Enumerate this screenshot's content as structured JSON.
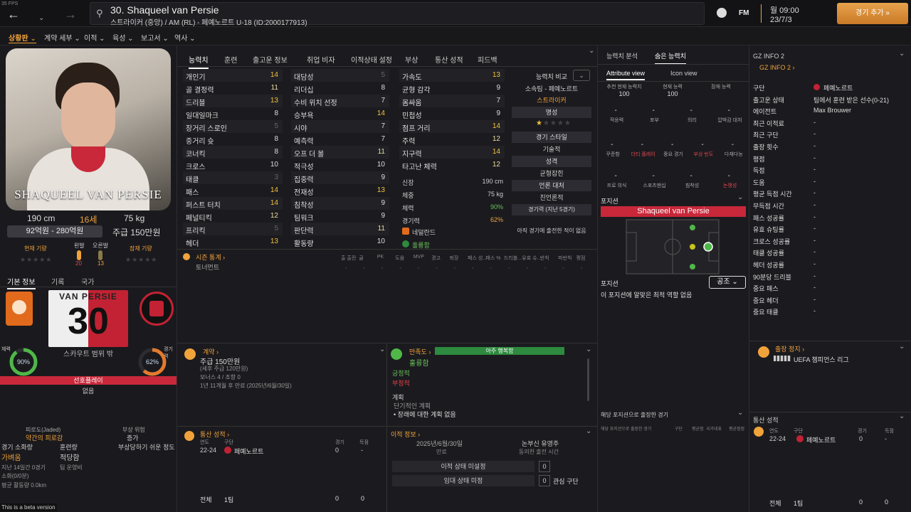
{
  "fps": "35 FPS",
  "header": {
    "title": "30. Shaqueel van Persie",
    "subtitle": "스트라이커 (중앙) / AM (RL) - 페예노르트 U-18 (ID:2000177913)",
    "fm_label": "FM",
    "day_time": "월 09:00",
    "date": "23/7/3",
    "continue_label": "경기 추가"
  },
  "subnav": [
    "상황판",
    "계약 세부",
    "이적",
    "육성",
    "보고서",
    "역사"
  ],
  "profile": {
    "name_overlay": "SHAQUEEL VAN PERSIE",
    "height": "190 cm",
    "age": "16세",
    "weight": "75 kg",
    "value_range": "92억원 - 280억원",
    "wage": "주급 150만원",
    "current_ability_label": "현재 기량",
    "left_foot_label": "왼발",
    "left_foot_value": "20",
    "right_foot_label": "오른발",
    "right_foot_value": "13",
    "potential_label": "잠재 기량"
  },
  "side_tabs": [
    "기본 정보",
    "기록",
    "국가"
  ],
  "shirt": {
    "name": "VAN PERSIE",
    "number": "30"
  },
  "scouting_label": "스카우트 범위 밖",
  "fitness": {
    "label": "체력",
    "value": "90%",
    "pct": 0.9
  },
  "match_sharp": {
    "label": "경기력",
    "value": "62%",
    "pct": 0.62
  },
  "first_xi": {
    "label": "선호플레이",
    "value": "없음"
  },
  "left_bottom": {
    "fatigue_label": "피로도(Jaded)",
    "fatigue_value": "약간의 피로감",
    "injury_label": "부상 위험",
    "injury_value": "증가",
    "condition_label": "경기 소화량",
    "condition_value": "훈련량",
    "injury_prone": "부상당하기 쉬운 정도",
    "status_value": "가벼움",
    "status2": "적당함",
    "last_year": "지난 14일간 0경기",
    "last_year2": "팀 운영비",
    "minutes": "소화(0/0분)",
    "distance": "평균 활동량 0.0km",
    "beta": "This is a beta version"
  },
  "attr_tabs": [
    "능력치",
    "훈련",
    "출고운 정보",
    "취업 비자",
    "이적상태 설정",
    "부상",
    "통산 성적",
    "피드백"
  ],
  "technical": [
    [
      "개인기",
      "14"
    ],
    [
      "골 결정력",
      "11"
    ],
    [
      "드리블",
      "13"
    ],
    [
      "일대일마크",
      "8"
    ],
    [
      "장거리 스로인",
      "5"
    ],
    [
      "중거리 슛",
      "8"
    ],
    [
      "코너킥",
      "8"
    ],
    [
      "크로스",
      "10"
    ],
    [
      "태클",
      "3"
    ],
    [
      "패스",
      "14"
    ],
    [
      "퍼스트 터치",
      "14"
    ],
    [
      "페널티킥",
      "12"
    ],
    [
      "프리킥",
      "5"
    ],
    [
      "헤더",
      "13"
    ]
  ],
  "mental": [
    [
      "대담성",
      "5"
    ],
    [
      "리더십",
      "8"
    ],
    [
      "수비 위치 선정",
      "7"
    ],
    [
      "승부욕",
      "14"
    ],
    [
      "시야",
      "7"
    ],
    [
      "예측력",
      "7"
    ],
    [
      "오프 더 볼",
      "11"
    ],
    [
      "적극성",
      "10"
    ],
    [
      "집중력",
      "9"
    ],
    [
      "전재성",
      "13"
    ],
    [
      "침착성",
      "9"
    ],
    [
      "팀워크",
      "9"
    ],
    [
      "판단력",
      "11"
    ],
    [
      "활동량",
      "10"
    ]
  ],
  "physical": [
    [
      "가속도",
      "13"
    ],
    [
      "균형 감각",
      "9"
    ],
    [
      "몸싸움",
      "7"
    ],
    [
      "민첩성",
      "9"
    ],
    [
      "점프 거리",
      "14"
    ],
    [
      "주력",
      "12"
    ],
    [
      "지구력",
      "14"
    ],
    [
      "타고난 체력",
      "12"
    ]
  ],
  "details": {
    "height_label": "신장",
    "height": "190 cm",
    "weight_label": "체중",
    "weight": "75 kg",
    "fitness_label": "체력",
    "fitness": "90%",
    "sharp_label": "경기력",
    "sharp": "62%",
    "nation": "네덜란드",
    "condition": "훌륭함"
  },
  "compare": {
    "label": "능력치 비교",
    "club_label": "소속팀 - 페예노르트",
    "role": "스트라이커",
    "rep_label": "명성",
    "style_label": "경기 스타일",
    "style": "기술적",
    "personality_label": "성격",
    "personality": "균형잡힌",
    "media_label": "언론 대처",
    "media": "친언론적",
    "form_label": "경기력 (지난 5경기)",
    "no_games": "아직 경기에 출전한 적이 없음"
  },
  "season": {
    "title": "시즌 통계",
    "tournament": "토너먼트",
    "cols": [
      "출 출전",
      "골",
      "PK",
      "도움",
      "MVP",
      "경고",
      "퇴장",
      "패스 성...",
      "패스 %",
      "드리블...",
      "유효 슈...",
      "반칙",
      "파반칙",
      "평점"
    ]
  },
  "contract": {
    "title": "계약",
    "wage": "주급 150만원",
    "sub1": "(세후 주급 120만원)",
    "sub2": "보너스 4 / 조항 0",
    "sub3": "1년 11개월 후 만료 (2025년/6월/30일)"
  },
  "happiness": {
    "title": "만족도",
    "bar": "아주 행복함",
    "overall": "훌륭함",
    "positive": "긍정적",
    "negative": "부정적",
    "plans": "계획",
    "short": "단기적인 계획",
    "bullet": "장래에 대한 계획 없음"
  },
  "career_mid": {
    "title": "통산 성적",
    "year_label": "연도",
    "club_label": "구단",
    "apps_label": "경기",
    "goals_label": "득점",
    "year": "22-24",
    "club": "페예노르트",
    "apps": "0",
    "goals": "-",
    "total_label": "전체",
    "total_team": "1팀",
    "total_apps": "0",
    "total_goals": "0"
  },
  "transfer": {
    "title": "이적 정보",
    "date": "2025년/6월/30일",
    "date_sub": "만료",
    "option": "논부신 유영주",
    "option_sub": "동의한 출전 시간",
    "status1": "이적 상태 미설정",
    "status1_v": "0",
    "status2": "임대 상태 미정",
    "status2_v": "0",
    "interest": "관심 구단"
  },
  "right_tabs": [
    "능력치 분석",
    "숨은 능력치"
  ],
  "view_tabs": [
    "Attribute view",
    "Icon view"
  ],
  "ability": {
    "rec_label": "추천 현재 능력치",
    "rec": "100",
    "cur_label": "현재 능력",
    "cur": "100",
    "pot_label": "잠재 능력"
  },
  "grid1": [
    "적응력",
    "포부",
    "의리",
    "압박감 대처"
  ],
  "grid2": [
    "꾸준함",
    "더티 플레이",
    "중요 경기",
    "부상 빈도",
    "다재다능"
  ],
  "grid3": [
    "프로 의식",
    "스포츠맨십",
    "침착성",
    "논쟁성"
  ],
  "position": {
    "title": "포지션",
    "name": "Shaqueel van Persie",
    "role_title": "포지션",
    "role_btn": "공조",
    "role_desc": "이 포지션에 알맞은 최적 역할 없음",
    "matches": "해당 포지션으로 출장한 경기",
    "cols": [
      "해당 포지션으로 출장한 경기",
      "구단",
      "평균점",
      "국가대표",
      "평균점점"
    ]
  },
  "info": {
    "title": "GZ INFO 2",
    "link": "GZ INFO 2",
    "rows": [
      [
        "구단",
        "페예노르트"
      ],
      [
        "출고운 상태",
        "팀에서 훈련 받은 선수(0-21)"
      ],
      [
        "에이전트",
        "Max Brouwer"
      ],
      [
        "최근 이적료",
        "-"
      ],
      [
        "최근 구단",
        "-"
      ],
      [
        "출장 횟수",
        "-"
      ],
      [
        "평점",
        "-"
      ],
      [
        "득점",
        "-"
      ],
      [
        "도움",
        "-"
      ],
      [
        "평균 득점 시간",
        "-"
      ],
      [
        "무득점 시간",
        "-"
      ],
      [
        "패스 성공률",
        "-"
      ],
      [
        "유효 슈팅률",
        "-"
      ],
      [
        "크로스 성공률",
        "-"
      ],
      [
        "태클 성공률",
        "-"
      ],
      [
        "헤더 성공률",
        "-"
      ],
      [
        "90분당 드리블",
        "-"
      ],
      [
        "중요 패스",
        "-"
      ],
      [
        "중요 헤더",
        "-"
      ],
      [
        "중요 태클",
        "-"
      ]
    ]
  },
  "suspension": {
    "title": "출장 정지",
    "value": "UEFA 챔피언스 리그"
  },
  "career_right": {
    "title": "통산 성적",
    "year_label": "연도",
    "club_label": "구단",
    "apps_label": "경기",
    "goals_label": "득점",
    "year": "22-24",
    "club": "페예노르트",
    "apps": "0",
    "goals": "-",
    "total_label": "전체",
    "total_team": "1팀",
    "total_apps": "0",
    "total_goals": "0"
  }
}
